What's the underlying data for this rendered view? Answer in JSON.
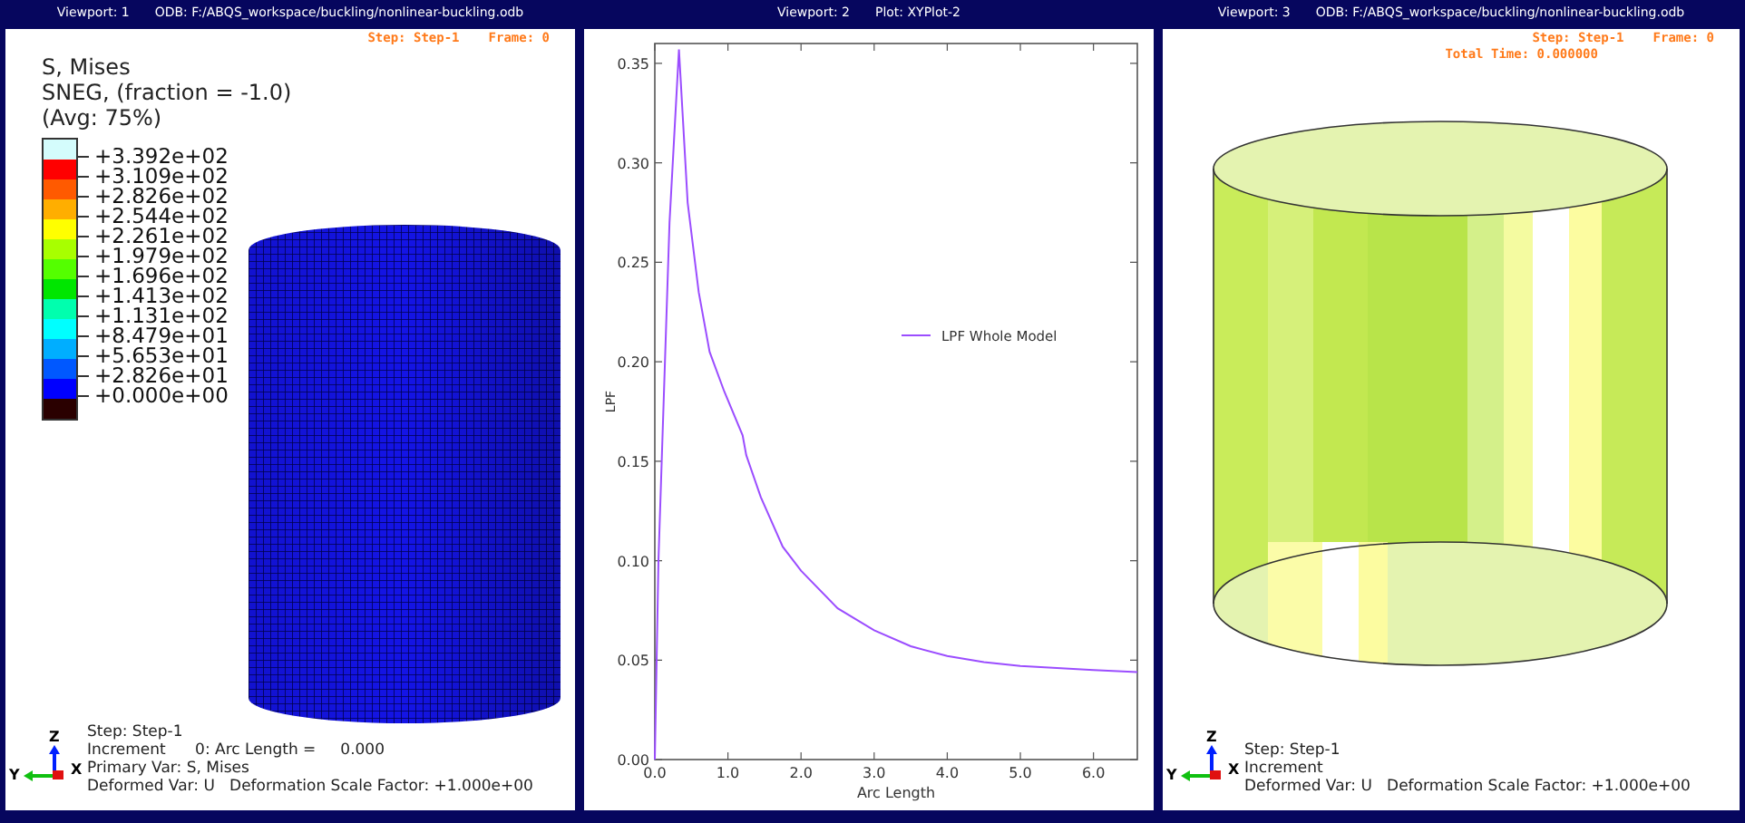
{
  "viewport_1": {
    "title": "Viewport: 1",
    "odb": "ODB: F:/ABQS_workspace/buckling/nonlinear-buckling.odb",
    "status": [
      "Step: Step-1",
      "Frame: 0"
    ],
    "legend": {
      "title_lines": [
        "S, Mises",
        "SNEG, (fraction = -1.0)",
        "(Avg: 75%)"
      ],
      "bands": [
        {
          "color": "#d4fcfc"
        },
        {
          "color": "#ff0000"
        },
        {
          "color": "#ff5a00"
        },
        {
          "color": "#ffae00"
        },
        {
          "color": "#ffff00"
        },
        {
          "color": "#a8ff00"
        },
        {
          "color": "#54ff00"
        },
        {
          "color": "#00e600"
        },
        {
          "color": "#00ffae"
        },
        {
          "color": "#00ffff"
        },
        {
          "color": "#00aeff"
        },
        {
          "color": "#0058ff"
        },
        {
          "color": "#0000ff"
        },
        {
          "color": "#2a0000"
        }
      ],
      "labels": [
        "+3.392e+02",
        "+3.109e+02",
        "+2.826e+02",
        "+2.544e+02",
        "+2.261e+02",
        "+1.979e+02",
        "+1.696e+02",
        "+1.413e+02",
        "+1.131e+02",
        "+8.479e+01",
        "+5.653e+01",
        "+2.826e+01",
        "+0.000e+00"
      ]
    },
    "triad": {
      "z": "Z",
      "y": "Y",
      "x": "X"
    },
    "info_lines": [
      "Step: Step-1",
      "Increment      0: Arc Length =     0.000",
      "Primary Var: S, Mises",
      "Deformed Var: U   Deformation Scale Factor: +1.000e+00"
    ]
  },
  "viewport_2": {
    "title": "Viewport: 2",
    "plot": "Plot: XYPlot-2",
    "chart_data": {
      "type": "line",
      "xlabel": "Arc Length",
      "ylabel": "LPF",
      "xlim": [
        0,
        6.6
      ],
      "ylim": [
        0,
        0.36
      ],
      "xticks": [
        {
          "value": 0,
          "label": "0.0"
        },
        {
          "value": 1,
          "label": "1.0"
        },
        {
          "value": 2,
          "label": "2.0"
        },
        {
          "value": 3,
          "label": "3.0"
        },
        {
          "value": 4,
          "label": "4.0"
        },
        {
          "value": 5,
          "label": "5.0"
        },
        {
          "value": 6,
          "label": "6.0"
        }
      ],
      "yticks": [
        {
          "value": 0,
          "label": "0.00"
        },
        {
          "value": 0.05,
          "label": "0.05"
        },
        {
          "value": 0.1,
          "label": "0.10"
        },
        {
          "value": 0.15,
          "label": "0.15"
        },
        {
          "value": 0.2,
          "label": "0.20"
        },
        {
          "value": 0.25,
          "label": "0.25"
        },
        {
          "value": 0.3,
          "label": "0.30"
        },
        {
          "value": 0.35,
          "label": "0.35"
        }
      ],
      "x": [
        0,
        0.05,
        0.2,
        0.33,
        0.45,
        0.6,
        0.75,
        0.95,
        1.2,
        1.25,
        1.45,
        1.75,
        2.0,
        2.5,
        3.0,
        3.5,
        4.0,
        4.5,
        5.0,
        5.5,
        6.0,
        6.6
      ],
      "series": [
        {
          "name": "LPF Whole Model",
          "color": "#9b4dff",
          "values": [
            0,
            0.1,
            0.27,
            0.357,
            0.28,
            0.235,
            0.205,
            0.185,
            0.163,
            0.153,
            0.132,
            0.107,
            0.095,
            0.076,
            0.065,
            0.057,
            0.052,
            0.049,
            0.047,
            0.046,
            0.045,
            0.044
          ]
        }
      ]
    }
  },
  "viewport_3": {
    "title": "Viewport: 3",
    "odb": "ODB: F:/ABQS_workspace/buckling/nonlinear-buckling.odb",
    "status": [
      "Step: Step-1",
      "Frame: 0"
    ],
    "total_time": "Total Time: 0.000000",
    "triad": {
      "z": "Z",
      "y": "Y",
      "x": "X"
    },
    "info_lines": [
      "Step: Step-1",
      "Increment",
      "Deformed Var: U   Deformation Scale Factor: +1.000e+00"
    ]
  }
}
